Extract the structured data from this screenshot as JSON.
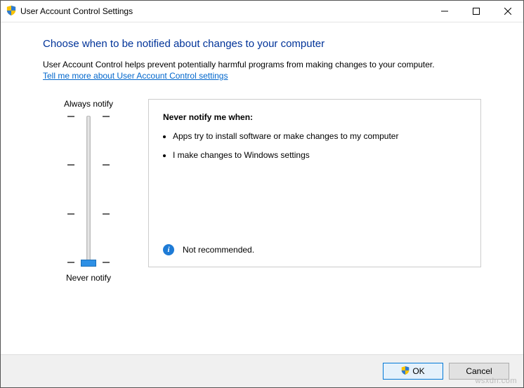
{
  "window": {
    "title": "User Account Control Settings"
  },
  "heading": "Choose when to be notified about changes to your computer",
  "description": "User Account Control helps prevent potentially harmful programs from making changes to your computer.",
  "link_text": "Tell me more about User Account Control settings",
  "slider": {
    "top_label": "Always notify",
    "bottom_label": "Never notify",
    "levels": 4,
    "current_level": 0
  },
  "panel": {
    "title": "Never notify me when:",
    "bullets": [
      "Apps try to install software or make changes to my computer",
      "I make changes to Windows settings"
    ],
    "recommendation": "Not recommended."
  },
  "buttons": {
    "ok": "OK",
    "cancel": "Cancel"
  },
  "watermark": "wsxdn.com"
}
